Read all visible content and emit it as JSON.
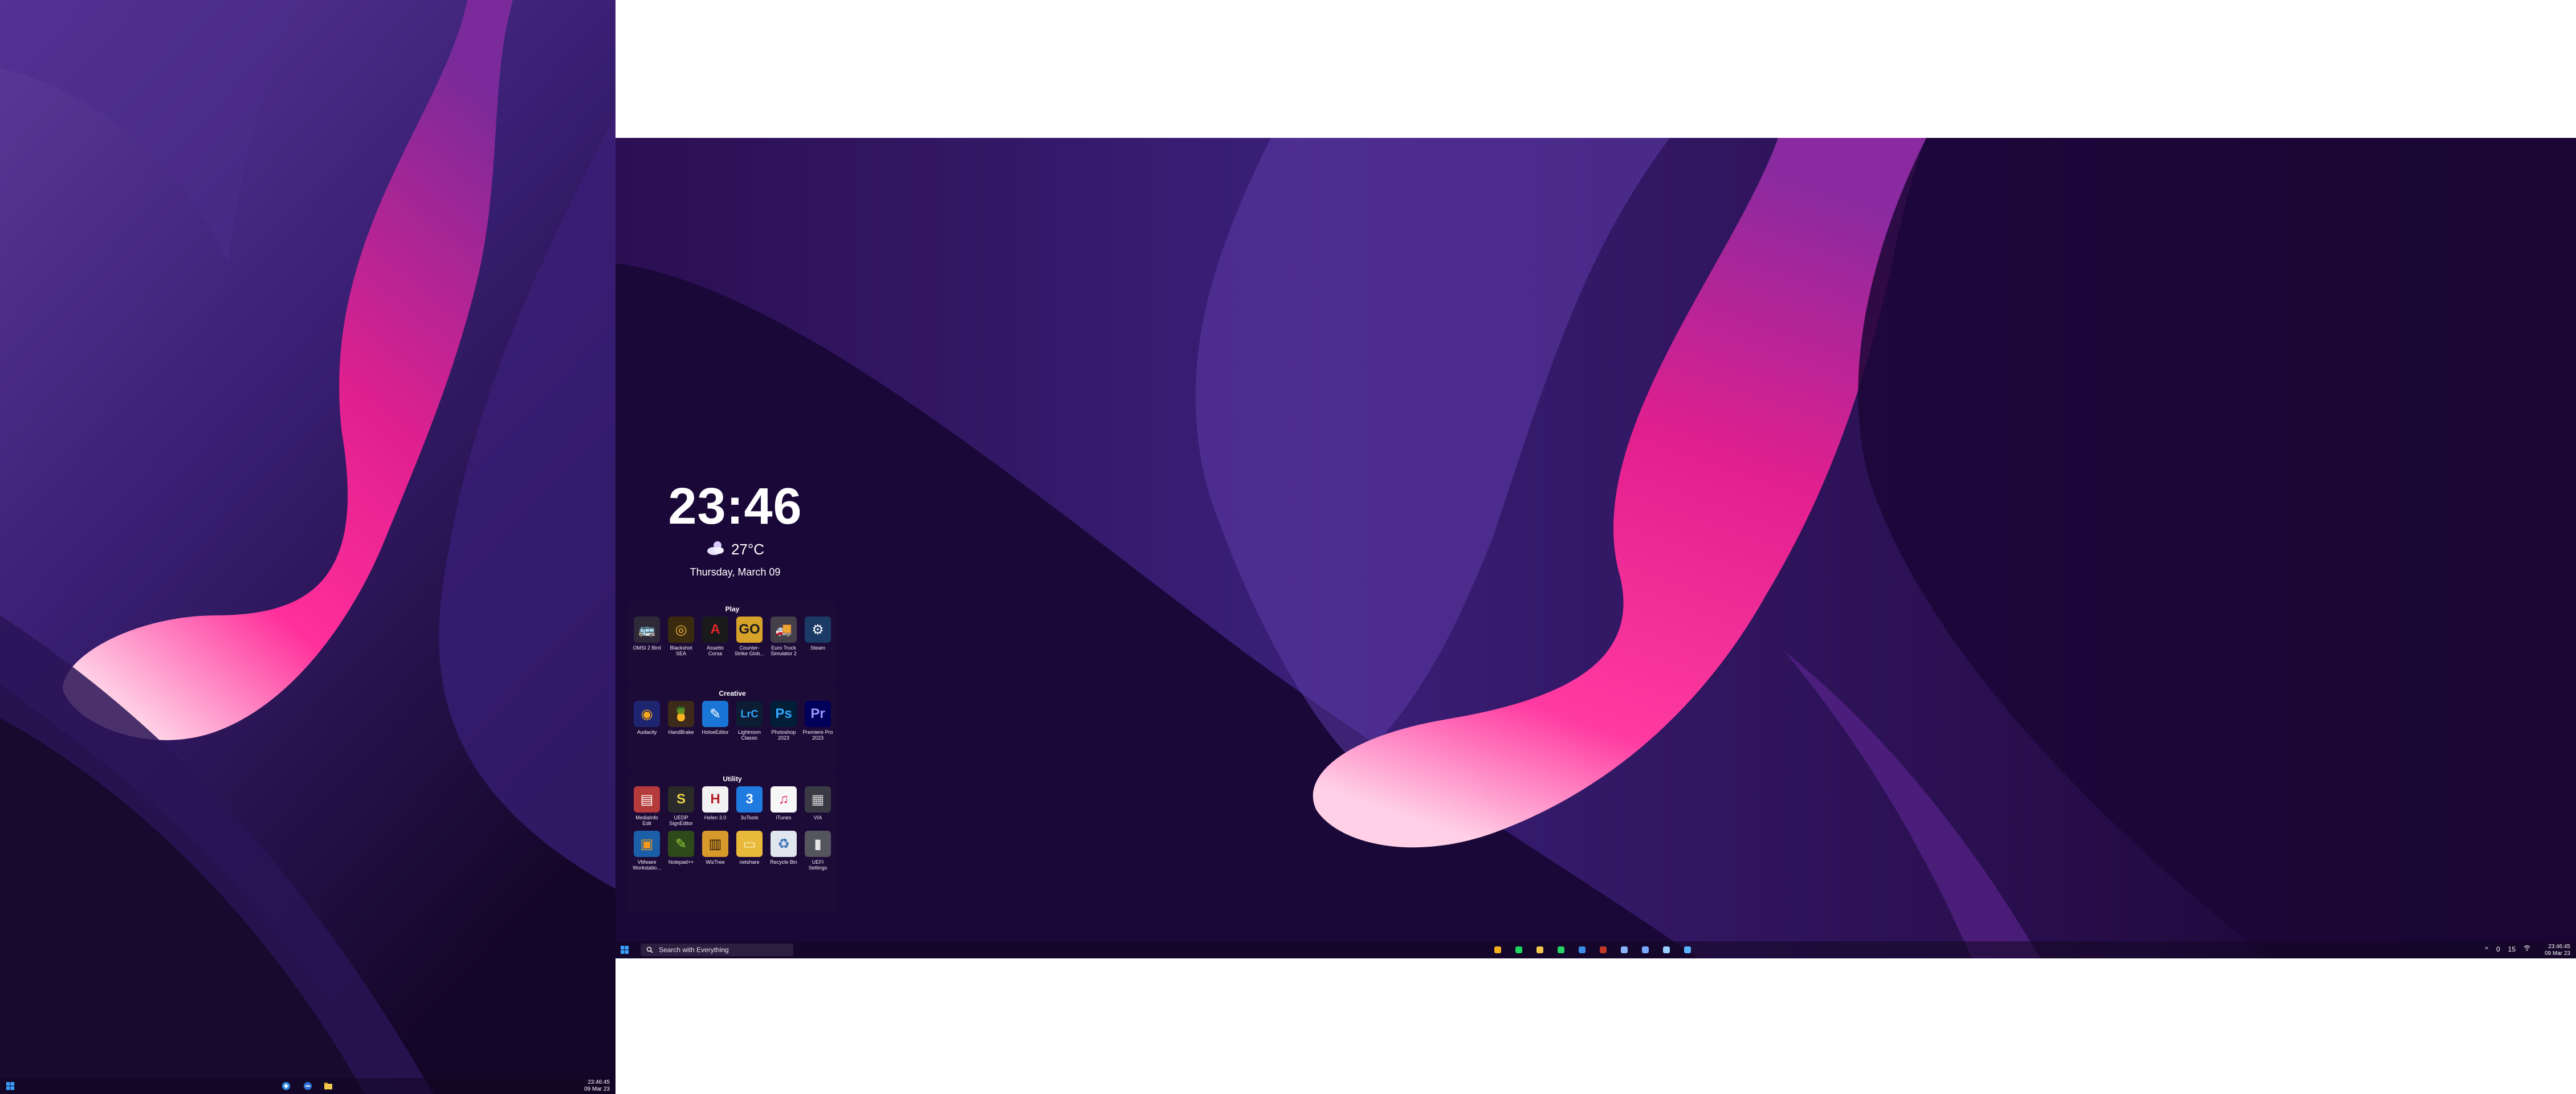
{
  "left_monitor": {
    "taskbar": {
      "clock_time": "23:46:45",
      "clock_date": "09 Mar 23",
      "icons": [
        "start-icon",
        "chrome-icon",
        "browser-icon",
        "folder-icon"
      ]
    }
  },
  "right_monitor": {
    "widget": {
      "time": "23:46",
      "temperature": "27°C",
      "weather_icon": "cloud-moon-icon",
      "date": "Thursday, March 09"
    },
    "groups": [
      {
        "title": "Play",
        "apps": [
          {
            "label": "OMSI 2 Bird",
            "icon": "bus-icon",
            "bg": "#2e2a3a",
            "fg": "#e0d5b0",
            "glyph": "🚌"
          },
          {
            "label": "Blackshot\nSEA",
            "icon": "blackshot-icon",
            "bg": "#3a2a10",
            "fg": "#f3b53a",
            "glyph": "◎"
          },
          {
            "label": "Assetto\nCorsa",
            "icon": "assetto-corsa-icon",
            "bg": "#1a1a1a",
            "fg": "#e0262c",
            "glyph": "A"
          },
          {
            "label": "Counter-\nStrike Glob...",
            "icon": "csgo-icon",
            "bg": "#d7a22a",
            "fg": "#1b1b1b",
            "glyph": "GO"
          },
          {
            "label": "Euro Truck\nSimulator 2",
            "icon": "truck-icon",
            "bg": "#44404a",
            "fg": "#d8d8d8",
            "glyph": "🚚"
          },
          {
            "label": "Steam",
            "icon": "steam-icon",
            "bg": "#1b3a66",
            "fg": "#ffffff",
            "glyph": "⚙"
          }
        ]
      },
      {
        "title": "Creative",
        "apps": [
          {
            "label": "Audacity",
            "icon": "audacity-icon",
            "bg": "#1e2570",
            "fg": "#f6a81a",
            "glyph": "◉"
          },
          {
            "label": "HandBrake",
            "icon": "handbrake-icon",
            "bg": "#3d2a1a",
            "fg": "#f2a53a",
            "glyph": "🍍"
          },
          {
            "label": "HoloeEditor",
            "icon": "editor-icon",
            "bg": "#1a76d6",
            "fg": "#ffffff",
            "glyph": "✎"
          },
          {
            "label": "Lightroom\nClassic",
            "icon": "lightroom-icon",
            "bg": "#0b1c33",
            "fg": "#31a8ff",
            "glyph": "LrC"
          },
          {
            "label": "Photoshop\n2023",
            "icon": "photoshop-icon",
            "bg": "#001e36",
            "fg": "#31a8ff",
            "glyph": "Ps"
          },
          {
            "label": "Premiere Pro\n2023",
            "icon": "premiere-icon",
            "bg": "#00005b",
            "fg": "#9999ff",
            "glyph": "Pr"
          }
        ]
      },
      {
        "title": "Utility",
        "apps": [
          {
            "label": "MediaInfo\nEdit",
            "icon": "mediainfo-icon",
            "bg": "#b53a3a",
            "fg": "#ffffff",
            "glyph": "▤"
          },
          {
            "label": "UEDP\nSignEditor",
            "icon": "signeditor-icon",
            "bg": "#2a2a2a",
            "fg": "#e6d34a",
            "glyph": "S"
          },
          {
            "label": "Helen 3.0",
            "icon": "helen-icon",
            "bg": "#f2f2f2",
            "fg": "#b4202a",
            "glyph": "H"
          },
          {
            "label": "3uTools",
            "icon": "3utools-icon",
            "bg": "#1f7be0",
            "fg": "#ffffff",
            "glyph": "3"
          },
          {
            "label": "iTunes",
            "icon": "itunes-icon",
            "bg": "#f7f7f7",
            "fg": "#e0245e",
            "glyph": "♫"
          },
          {
            "label": "VIA",
            "icon": "via-icon",
            "bg": "#3a3a44",
            "fg": "#cfcfcf",
            "glyph": "▦"
          },
          {
            "label": "VMware\nWorkstatio...",
            "icon": "vmware-icon",
            "bg": "#1b5fa8",
            "fg": "#f29a1b",
            "glyph": "▣"
          },
          {
            "label": "Notepad++",
            "icon": "notepadpp-icon",
            "bg": "#2e4a1a",
            "fg": "#9bd43a",
            "glyph": "✎"
          },
          {
            "label": "WizTree",
            "icon": "wiztree-icon",
            "bg": "#d79a2a",
            "fg": "#2b1a0a",
            "glyph": "▥"
          },
          {
            "label": "netshare",
            "icon": "folder-icon",
            "bg": "#e8b93a",
            "fg": "#fff3c4",
            "glyph": "▭"
          },
          {
            "label": "Recycle Bin",
            "icon": "recycle-bin-icon",
            "bg": "#dfe6ee",
            "fg": "#3b6fb5",
            "glyph": "♻"
          },
          {
            "label": "UEFI\nSettings",
            "icon": "uefi-icon",
            "bg": "#55555e",
            "fg": "#e6e6e6",
            "glyph": "▮"
          }
        ]
      }
    ],
    "taskbar": {
      "search_placeholder": "Search with Everything",
      "clock_time": "23:46:45",
      "clock_date": "09 Mar 23",
      "tray_items": [
        "^",
        "0",
        "15"
      ],
      "pinned_icons": [
        {
          "name": "chrome-icon",
          "color": "#f2b01e"
        },
        {
          "name": "spotify-icon",
          "color": "#1ed760"
        },
        {
          "name": "file-explorer-icon",
          "color": "#f2c94c"
        },
        {
          "name": "whatsapp-icon",
          "color": "#25d366"
        },
        {
          "name": "mail-icon",
          "color": "#3a8ee6"
        },
        {
          "name": "app-icon",
          "color": "#c0392b"
        },
        {
          "name": "settings-icon",
          "color": "#8ab4f8"
        },
        {
          "name": "terminal-icon",
          "color": "#7aa7ff"
        },
        {
          "name": "task-manager-icon",
          "color": "#9ad0ff"
        },
        {
          "name": "snipping-icon",
          "color": "#5ab3ff"
        }
      ]
    }
  }
}
